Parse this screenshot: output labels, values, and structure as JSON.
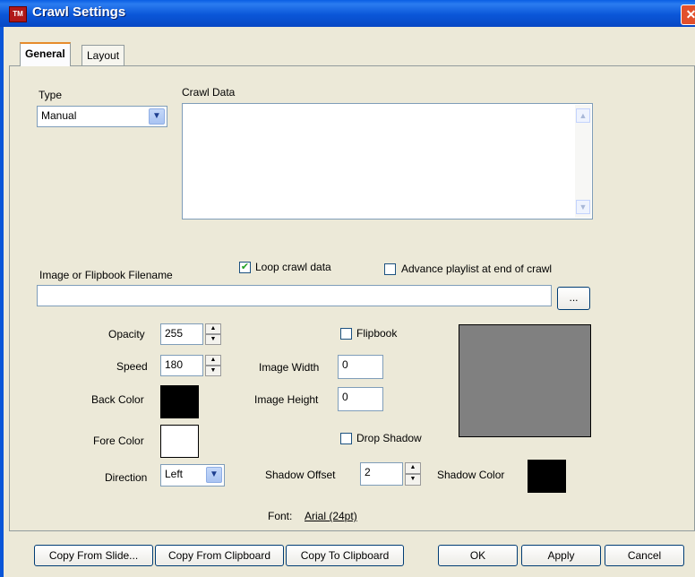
{
  "window": {
    "title": "Crawl Settings",
    "app_icon": "TM",
    "close_symbol": "✕"
  },
  "tabs": [
    {
      "label": "General",
      "active": true
    },
    {
      "label": "Layout",
      "active": false
    }
  ],
  "type": {
    "label": "Type",
    "value": "Manual"
  },
  "crawl_data": {
    "label": "Crawl Data",
    "value": ""
  },
  "loop_crawl": {
    "label": "Loop crawl data",
    "checked": true
  },
  "advance_playlist": {
    "label": "Advance playlist at end of crawl",
    "checked": false
  },
  "image_file": {
    "label": "Image or Flipbook Filename",
    "value": "",
    "browse_label": "..."
  },
  "opacity": {
    "label": "Opacity",
    "value": "255"
  },
  "speed": {
    "label": "Speed",
    "value": "180"
  },
  "back_color": {
    "label": "Back Color",
    "color": "#000000"
  },
  "fore_color": {
    "label": "Fore Color",
    "color": "#FFFFFF"
  },
  "direction": {
    "label": "Direction",
    "value": "Left"
  },
  "flipbook": {
    "label": "Flipbook",
    "checked": false
  },
  "image_width": {
    "label": "Image Width",
    "value": "0"
  },
  "image_height": {
    "label": "Image Height",
    "value": "0"
  },
  "drop_shadow": {
    "label": "Drop Shadow",
    "checked": false
  },
  "shadow_offset": {
    "label": "Shadow Offset",
    "value": "2"
  },
  "shadow_color": {
    "label": "Shadow Color",
    "color": "#000000"
  },
  "preview": {
    "color": "#808080"
  },
  "font": {
    "label": "Font:",
    "value": "Arial (24pt)"
  },
  "buttons": {
    "copy_from_slide": "Copy From Slide...",
    "copy_from_clipboard": "Copy From Clipboard",
    "copy_to_clipboard": "Copy To Clipboard",
    "ok": "OK",
    "apply": "Apply",
    "cancel": "Cancel"
  }
}
